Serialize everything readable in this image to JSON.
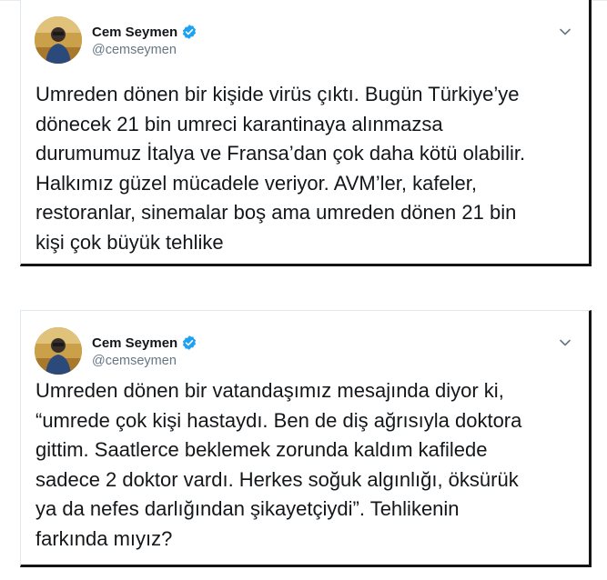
{
  "tweets": [
    {
      "author_name": "Cem Seymen",
      "handle": "@cemseymen",
      "verified": true,
      "lines": [
        "Umreden dönen bir kişide virüs çıktı. Bugün Türkiye’ye",
        "dönecek 21 bin umreci karantinaya alınmazsa",
        "durumumuz İtalya ve Fransa’dan çok daha kötü olabilir.",
        "Halkımız güzel mücadele veriyor. AVM’ler, kafeler,",
        "restoranlar, sinemalar boş ama umreden dönen 21 bin",
        "kişi çok büyük tehlike"
      ]
    },
    {
      "author_name": "Cem Seymen",
      "handle": "@cemseymen",
      "verified": true,
      "lines": [
        "Umreden dönen bir vatandaşımız mesajında diyor ki,",
        "“umrede çok kişi hastaydı. Ben de diş ağrısıyla doktora",
        "gittim. Saatlerce beklemek zorunda kaldım kafilede",
        "sadece 2 doktor vardı. Herkes soğuk algınlığı, öksürük",
        "ya da nefes darlığından şikayetçiydi”. Tehlikenin",
        "farkında mıyız?"
      ]
    }
  ],
  "colors": {
    "verified_badge": "#1da1f2",
    "text": "#14171a",
    "handle": "#657786"
  },
  "icons": [
    "verified-badge-icon",
    "chevron-down-icon"
  ]
}
